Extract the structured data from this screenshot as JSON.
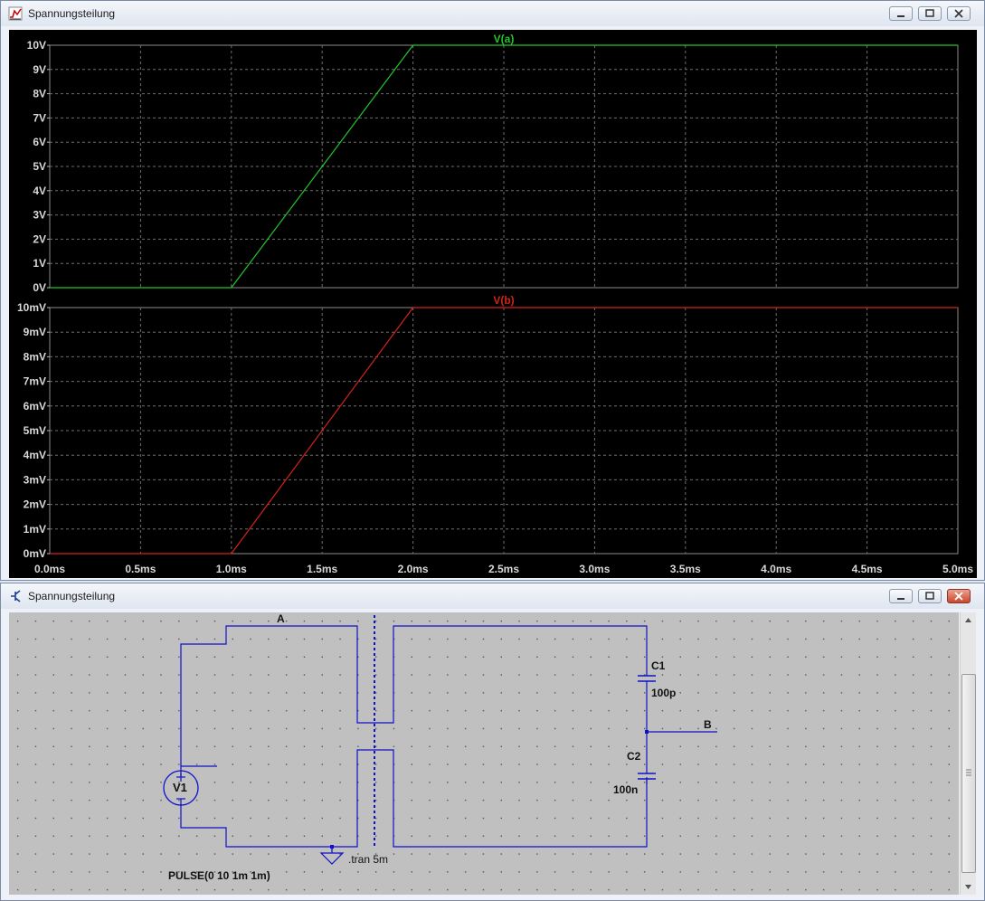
{
  "plot_window": {
    "title": "Spannungsteilung"
  },
  "schematic_window": {
    "title": "Spannungsteilung"
  },
  "colors": {
    "trace_a": "#22c52b",
    "trace_b": "#d3221b",
    "wire": "#1010c8",
    "plot_bg": "#000000",
    "schematic_bg": "#c0c0c0"
  },
  "chart_data": [
    {
      "type": "line",
      "title": "",
      "series": [
        {
          "name": "V(a)",
          "x": [
            0,
            1.0,
            2.0,
            5.0
          ],
          "y": [
            0,
            0,
            10,
            10
          ]
        }
      ],
      "xlim": [
        0,
        5
      ],
      "ylim": [
        0,
        10
      ],
      "ytick_labels": [
        "0V",
        "1V",
        "2V",
        "3V",
        "4V",
        "5V",
        "6V",
        "7V",
        "8V",
        "9V",
        "10V"
      ],
      "grid": true
    },
    {
      "type": "line",
      "title": "",
      "series": [
        {
          "name": "V(b)",
          "x": [
            0,
            1.0,
            2.0,
            5.0
          ],
          "y": [
            0,
            0,
            10,
            10
          ]
        }
      ],
      "xlim": [
        0,
        5
      ],
      "ylim": [
        0,
        10
      ],
      "ytick_labels": [
        "0mV",
        "1mV",
        "2mV",
        "3mV",
        "4mV",
        "5mV",
        "6mV",
        "7mV",
        "8mV",
        "9mV",
        "10mV"
      ],
      "xtick_labels": [
        "0.0ms",
        "0.5ms",
        "1.0ms",
        "1.5ms",
        "2.0ms",
        "2.5ms",
        "3.0ms",
        "3.5ms",
        "4.0ms",
        "4.5ms",
        "5.0ms"
      ],
      "grid": true
    }
  ],
  "schematic": {
    "net_a": "A",
    "net_b": "B",
    "v1_name": "V1",
    "v1_value": "PULSE(0 10 1m 1m)",
    "c1_name": "C1",
    "c1_value": "100p",
    "c2_name": "C2",
    "c2_value": "100n",
    "directive": ".tran 5m"
  }
}
